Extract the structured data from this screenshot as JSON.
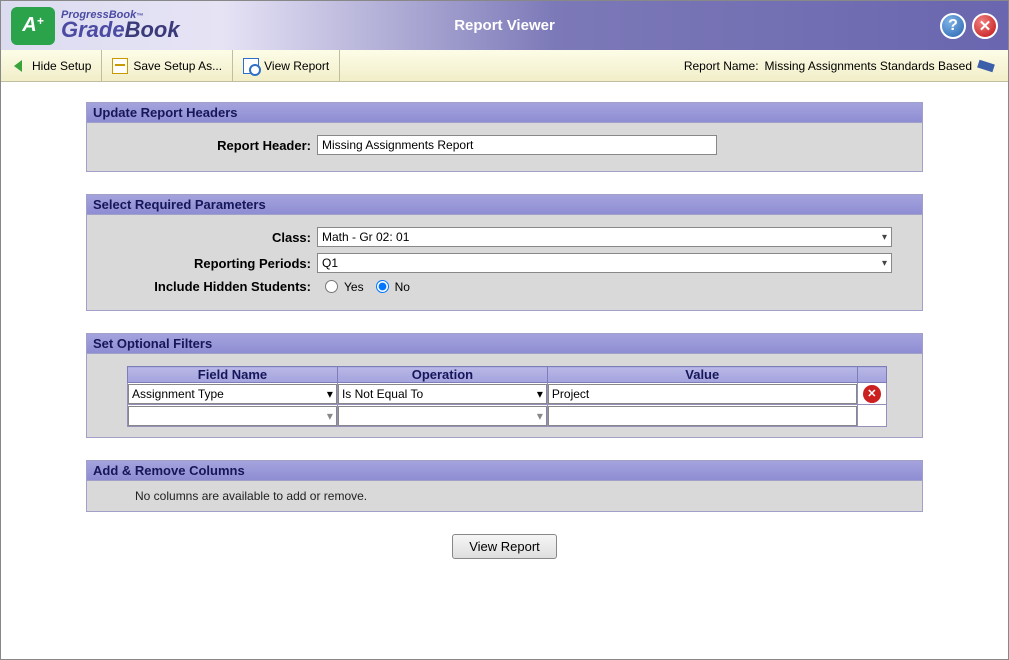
{
  "header": {
    "title": "Report Viewer",
    "logo": {
      "badge": "A+",
      "line1": "ProgressBook",
      "line2a": "Grade",
      "line2b": "Book"
    }
  },
  "toolbar": {
    "hide_setup": "Hide Setup",
    "save_as": "Save Setup As...",
    "view_report": "View Report",
    "report_name_label": "Report Name:",
    "report_name_value": "Missing Assignments Standards Based"
  },
  "update_headers": {
    "title": "Update Report Headers",
    "label": "Report Header:",
    "value": "Missing Assignments Report"
  },
  "required_params": {
    "title": "Select Required Parameters",
    "class_label": "Class:",
    "class_value": "Math - Gr 02: 01",
    "periods_label": "Reporting Periods:",
    "periods_value": "Q1",
    "hidden_label": "Include Hidden Students:",
    "yes": "Yes",
    "no": "No",
    "hidden_selected": "No"
  },
  "filters": {
    "title": "Set Optional Filters",
    "cols": {
      "field": "Field Name",
      "op": "Operation",
      "val": "Value"
    },
    "rows": [
      {
        "field": "Assignment Type",
        "op": "Is Not Equal To",
        "val": "Project",
        "delete": true
      },
      {
        "field": "",
        "op": "",
        "val": "",
        "delete": false
      }
    ]
  },
  "columns": {
    "title": "Add & Remove Columns",
    "msg": "No columns are available to add or remove."
  },
  "view_button": "View Report"
}
